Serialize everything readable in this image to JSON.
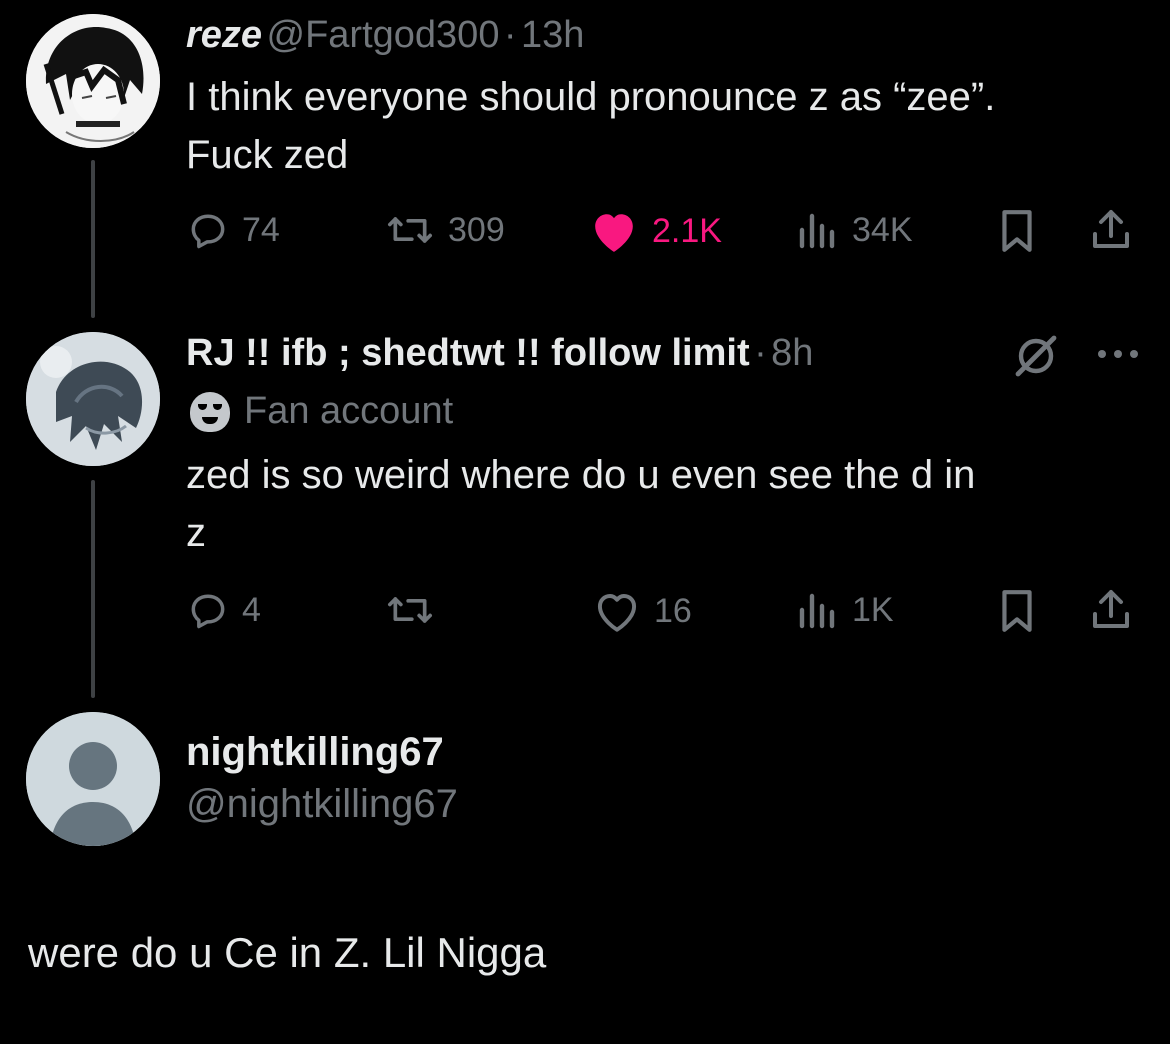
{
  "tweet1": {
    "display_name": "reze",
    "handle": "@Fartgod300",
    "separator": "·",
    "time": "13h",
    "text_line1": "I think everyone should pronounce z as “zee”.",
    "text_line2": "Fuck zed",
    "replies": "74",
    "retweets": "309",
    "likes": "2.1K",
    "views": "34K",
    "liked": true
  },
  "tweet2": {
    "display_name": "RJ !! ifb ; shedtwt !! follow limit",
    "separator": "·",
    "time": "8h",
    "label": "Fan account",
    "text_line1": "zed is so weird where do u even see the d in",
    "text_line2": "z",
    "replies": "4",
    "retweets": "",
    "likes": "16",
    "views": "1K"
  },
  "reply_profile": {
    "display_name": "nightkilling67",
    "handle": "@nightkilling67"
  },
  "reply_text": "were do u Ce in Z. Lil Nigga",
  "colors": {
    "background": "#000000",
    "text": "#e7e9ea",
    "muted": "#71767b",
    "like_pink": "#f91880"
  },
  "icons": [
    "reply-icon",
    "retweet-icon",
    "heart-icon",
    "views-icon",
    "bookmark-icon",
    "share-icon",
    "grok-icon",
    "more-icon",
    "fan-mask-icon"
  ]
}
